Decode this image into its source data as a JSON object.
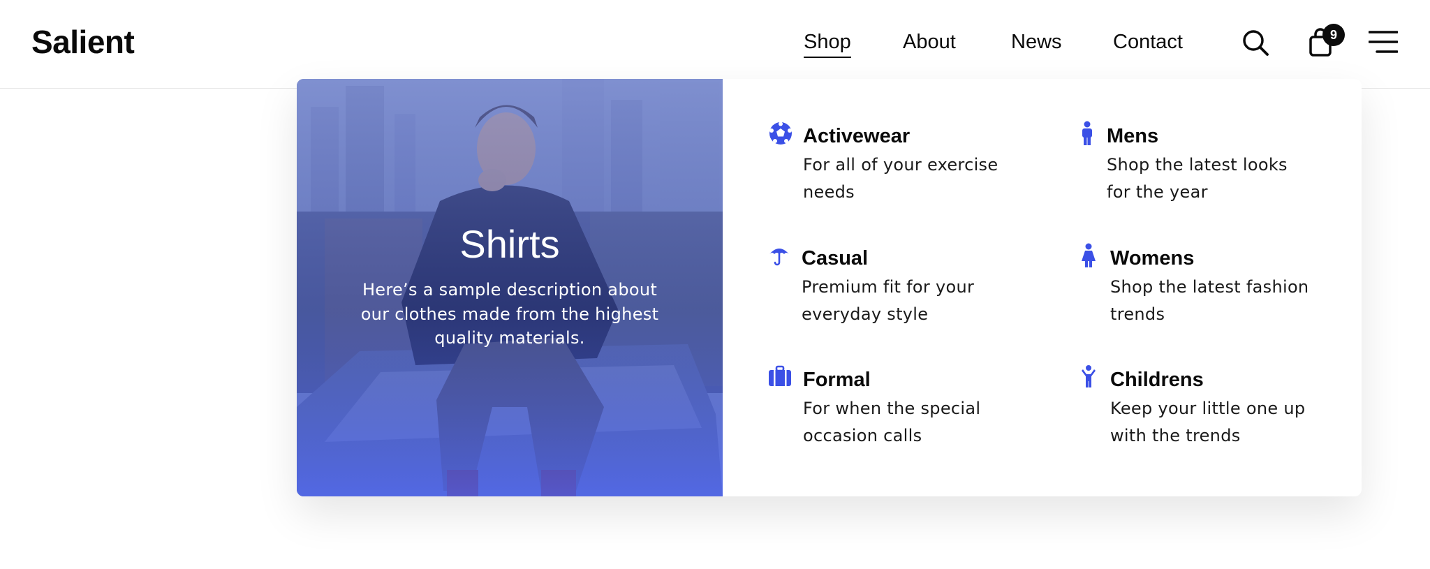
{
  "brand": {
    "logo": "Salient"
  },
  "nav": {
    "items": [
      {
        "label": "Shop",
        "active": true
      },
      {
        "label": "About"
      },
      {
        "label": "News"
      },
      {
        "label": "Contact"
      }
    ],
    "cart_count": "9",
    "icons": [
      "search-icon",
      "shopping-bag-icon",
      "menu-icon"
    ]
  },
  "mega_menu": {
    "promo": {
      "title": "Shirts",
      "description": "Here’s a sample description about our clothes made from the highest quality materials."
    },
    "categories": [
      {
        "title": "Activewear",
        "description": "For all of your exercise needs",
        "icon": "soccer-ball-icon"
      },
      {
        "title": "Mens",
        "description": "Shop the latest looks for the year",
        "icon": "male-icon"
      },
      {
        "title": "Casual",
        "description": "Premium fit for your everyday style",
        "icon": "umbrella-icon"
      },
      {
        "title": "Womens",
        "description": "Shop the latest fashion trends",
        "icon": "female-icon"
      },
      {
        "title": "Formal",
        "description": "For when the special occasion calls",
        "icon": "briefcase-icon"
      },
      {
        "title": "Childrens",
        "description": "Keep your little one up with the trends",
        "icon": "child-icon"
      }
    ],
    "accent_color": "#3b50e6"
  }
}
